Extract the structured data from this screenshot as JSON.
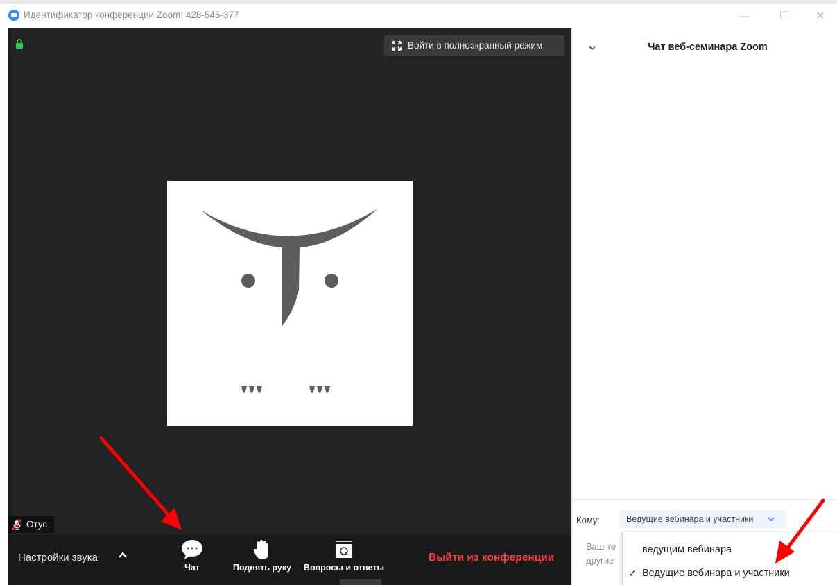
{
  "window": {
    "title": "Идентификатор конференции Zoom: 428-545-377",
    "min_glyph": "—",
    "max_glyph": "☐",
    "close_glyph": "✕"
  },
  "video": {
    "fullscreen_label": "Войти в полноэкранный режим",
    "participant_name": "Отус"
  },
  "toolbar": {
    "audio_settings_label": "Настройки звука",
    "chat_label": "Чат",
    "raise_hand_label": "Поднять руку",
    "qa_label": "Вопросы и ответы",
    "leave_label": "Выйти из конференции"
  },
  "chat": {
    "title": "Чат веб-семинара Zoom",
    "to_label": "Кому:",
    "to_value": "Ведущие вебинара и участники",
    "placeholder_line1": "Ваш те",
    "placeholder_line2": "другие"
  },
  "dropdown": {
    "options": [
      {
        "label": "ведущим вебинара",
        "selected": false
      },
      {
        "label": "Ведущие вебинара и участники",
        "selected": true
      }
    ],
    "check_glyph": "✓"
  },
  "colors": {
    "video_bg": "#232323",
    "toolbar_bg": "#1a1a1a",
    "leave_red": "#ff3b3b",
    "annotation_red": "#ff0000",
    "zoom_blue": "#2d8cff"
  },
  "icons": [
    "zoom-logo-icon",
    "lock-icon",
    "fullscreen-icon",
    "muted-mic-icon",
    "caret-up-icon",
    "chat-bubble-icon",
    "raise-hand-icon",
    "qa-icon",
    "chevron-down-icon",
    "checkmark-icon"
  ]
}
